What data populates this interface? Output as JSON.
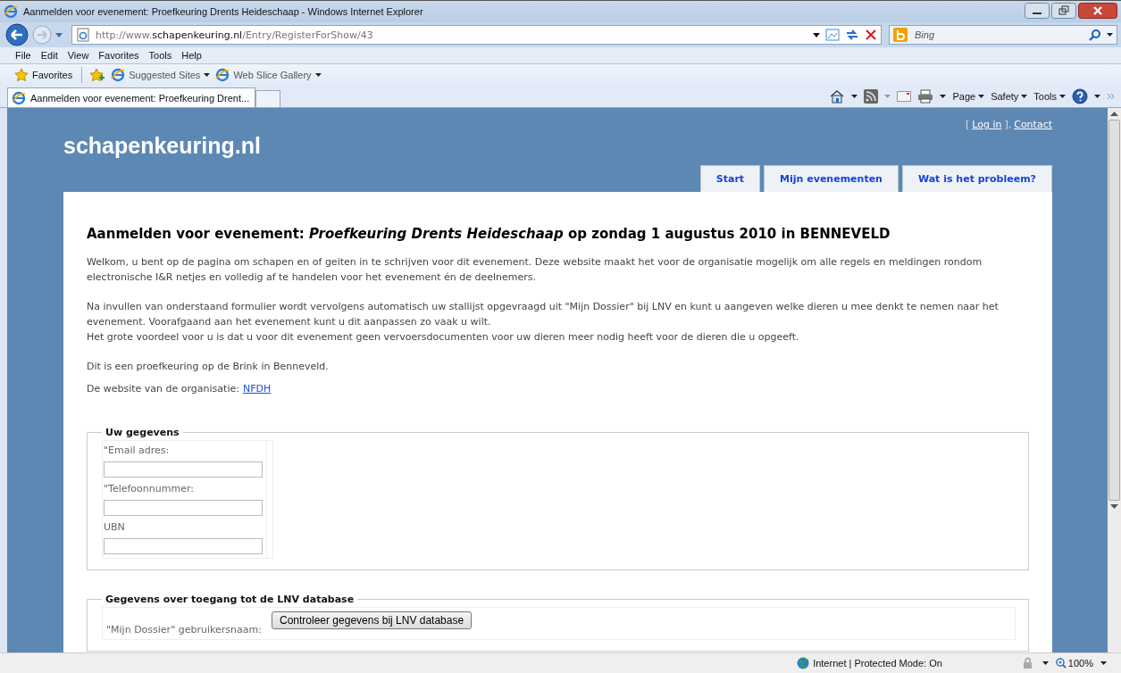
{
  "window": {
    "title": "Aanmelden voor evenement: Proefkeuring Drents Heideschaap - Windows Internet Explorer"
  },
  "address_bar": {
    "url": "http://www.**schapenkeuring.nl**/Entry/RegisterForShow/43"
  },
  "search": {
    "placeholder": "Bing"
  },
  "menu": [
    "File",
    "Edit",
    "View",
    "Favorites",
    "Tools",
    "Help"
  ],
  "favorites_bar": {
    "favorites": "Favorites",
    "links": [
      "Suggested Sites",
      "Web Slice Gallery"
    ]
  },
  "tabs": [
    {
      "label": "Aanmelden voor evenement: Proefkeuring Drent...",
      "selected": true
    }
  ],
  "command_bar": [
    "Page",
    "Safety",
    "Tools"
  ],
  "page": {
    "site_title": "schapenkeuring.nl",
    "account": {
      "open": "[",
      "login": "Log in",
      "close": "],",
      "contact": "Contact"
    },
    "nav": [
      {
        "label": "Start"
      },
      {
        "label": "Mijn evenementen"
      },
      {
        "label": "Wat is het probleem?"
      }
    ],
    "heading": "Aanmelden voor evenement: *Proefkeuring Drents Heideschaap* op zondag 1 augustus 2010 in BENNEVELD",
    "paragraphs": [
      [
        "Welkom, u bent op de pagina om schapen en of geiten in te schrijven voor dit evenement. Deze website maakt het voor de organisatie mogelijk om alle regels en meldingen rondom electronische I&R netjes en volledig af te handelen voor het evenement én de deelnemers."
      ],
      [
        "Na invullen van onderstaand formulier wordt vervolgens automatisch uw stallijst opgevraagd uit \"Mijn Dossier\" bij LNV en kunt u aangeven welke dieren u mee denkt te nemen naar het evenement. Voorafgaand aan het evenement kunt u dit aanpassen zo vaak u wilt.",
        "Het grote voordeel voor u is dat u voor dit evenement geen vervoersdocumenten voor uw dieren meer nodig heeft voor de dieren die u opgeeft."
      ],
      [
        "Dit is een proefkeuring op de Brink in Benneveld."
      ]
    ],
    "organisation": {
      "text": "De website van de organisatie:",
      "link": "NFDH"
    },
    "fieldsets": [
      {
        "legend": "Uw gegevens",
        "fields": [
          {
            "label": "\"Email adres:"
          },
          {
            "label": "\"Telefoonnummer:"
          },
          {
            "label": "UBN"
          }
        ]
      },
      {
        "legend": "Gegevens over toegang tot de LNV database",
        "label": "\"Mijn Dossier\" gebruikersnaam:",
        "button": "Controleer gegevens bij LNV database"
      }
    ]
  },
  "status_bar": {
    "zone": "Internet | Protected Mode: On",
    "zoom": "100%"
  }
}
